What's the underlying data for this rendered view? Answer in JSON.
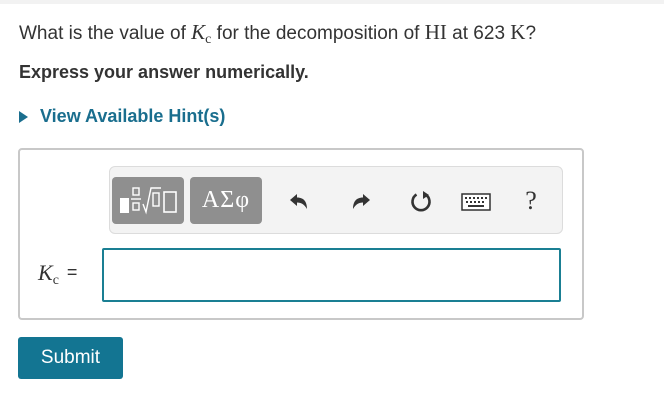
{
  "question": {
    "prefix": "What is the value of ",
    "k_symbol": "K",
    "k_subscript": "c",
    "middle": " for the decomposition of ",
    "compound": "HI",
    "at_text": " at 623 ",
    "unit": "K",
    "suffix": "?"
  },
  "instruction": "Express your answer numerically.",
  "hint": {
    "label": "View Available Hint(s)"
  },
  "toolbar": {
    "greek_label": "ΑΣφ",
    "help_label": "?",
    "icons": [
      "templates-icon",
      "undo-icon",
      "redo-icon",
      "reset-icon",
      "keyboard-icon"
    ]
  },
  "answer": {
    "k_symbol": "K",
    "k_subscript": "c",
    "equals": "=",
    "value": ""
  },
  "submit_label": "Submit",
  "colors": {
    "link": "#1a6e8e",
    "submit_bg": "#137592",
    "input_border": "#1a7f93",
    "toolbar_button_bg": "#8f8f8f"
  }
}
